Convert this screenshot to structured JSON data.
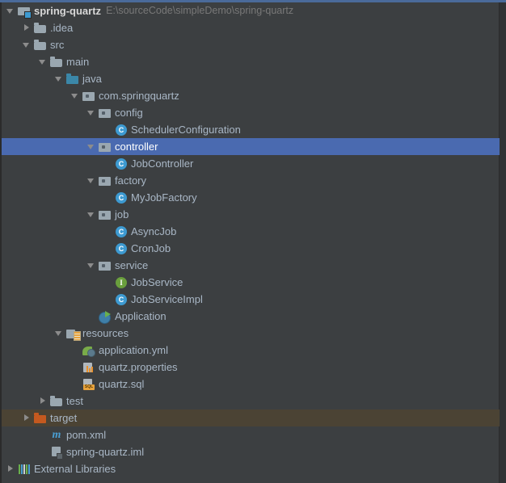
{
  "project": {
    "root_label": "spring-quartz",
    "root_path": "E:\\sourceCode\\simpleDemo\\spring-quartz"
  },
  "colors": {
    "background": "#3c3f41",
    "text": "#a9b7c6",
    "selection": "#4a6ab0",
    "excluded_row": "#4b4334",
    "path_text": "#787878"
  },
  "tree": [
    {
      "label": "spring-quartz",
      "suffix": "E:\\sourceCode\\simpleDemo\\spring-quartz",
      "icon": "folder-module-icon",
      "arrow": "down",
      "indent": 0,
      "state": "root"
    },
    {
      "label": ".idea",
      "icon": "folder-icon",
      "arrow": "right",
      "indent": 1,
      "state": "normal"
    },
    {
      "label": "src",
      "icon": "folder-icon",
      "arrow": "down",
      "indent": 1,
      "state": "normal"
    },
    {
      "label": "main",
      "icon": "folder-icon",
      "arrow": "down",
      "indent": 2,
      "state": "normal"
    },
    {
      "label": "java",
      "icon": "folder-source-icon",
      "arrow": "down",
      "indent": 3,
      "state": "normal"
    },
    {
      "label": "com.springquartz",
      "icon": "package-icon",
      "arrow": "down",
      "indent": 4,
      "state": "normal"
    },
    {
      "label": "config",
      "icon": "package-icon",
      "arrow": "down",
      "indent": 5,
      "state": "normal"
    },
    {
      "label": "SchedulerConfiguration",
      "icon": "class-icon",
      "arrow": "none",
      "indent": 6,
      "state": "normal"
    },
    {
      "label": "controller",
      "icon": "package-icon",
      "arrow": "down",
      "indent": 5,
      "state": "selected"
    },
    {
      "label": "JobController",
      "icon": "class-icon",
      "arrow": "none",
      "indent": 6,
      "state": "normal"
    },
    {
      "label": "factory",
      "icon": "package-icon",
      "arrow": "down",
      "indent": 5,
      "state": "normal"
    },
    {
      "label": "MyJobFactory",
      "icon": "class-icon",
      "arrow": "none",
      "indent": 6,
      "state": "normal"
    },
    {
      "label": "job",
      "icon": "package-icon",
      "arrow": "down",
      "indent": 5,
      "state": "normal"
    },
    {
      "label": "AsyncJob",
      "icon": "class-icon",
      "arrow": "none",
      "indent": 6,
      "state": "normal"
    },
    {
      "label": "CronJob",
      "icon": "class-icon",
      "arrow": "none",
      "indent": 6,
      "state": "normal"
    },
    {
      "label": "service",
      "icon": "package-icon",
      "arrow": "down",
      "indent": 5,
      "state": "normal"
    },
    {
      "label": "JobService",
      "icon": "interface-icon",
      "arrow": "none",
      "indent": 6,
      "state": "normal"
    },
    {
      "label": "JobServiceImpl",
      "icon": "class-icon",
      "arrow": "none",
      "indent": 6,
      "state": "normal"
    },
    {
      "label": "Application",
      "icon": "spring-application-icon",
      "arrow": "none",
      "indent": 5,
      "state": "normal"
    },
    {
      "label": "resources",
      "icon": "folder-resource-icon",
      "arrow": "down",
      "indent": 3,
      "state": "normal"
    },
    {
      "label": "application.yml",
      "icon": "yml-file-icon",
      "arrow": "none",
      "indent": 4,
      "state": "normal"
    },
    {
      "label": "quartz.properties",
      "icon": "properties-file-icon",
      "arrow": "none",
      "indent": 4,
      "state": "normal"
    },
    {
      "label": "quartz.sql",
      "icon": "sql-file-icon",
      "arrow": "none",
      "indent": 4,
      "state": "normal"
    },
    {
      "label": "test",
      "icon": "folder-icon",
      "arrow": "right",
      "indent": 2,
      "state": "normal"
    },
    {
      "label": "target",
      "icon": "folder-excluded-icon",
      "arrow": "right",
      "indent": 1,
      "state": "excluded"
    },
    {
      "label": "pom.xml",
      "icon": "maven-file-icon",
      "arrow": "none",
      "indent": 2,
      "state": "normal"
    },
    {
      "label": "spring-quartz.iml",
      "icon": "iml-file-icon",
      "arrow": "none",
      "indent": 2,
      "state": "normal"
    },
    {
      "label": "External Libraries",
      "icon": "external-libraries-icon",
      "arrow": "right",
      "indent": 0,
      "state": "normal"
    }
  ]
}
